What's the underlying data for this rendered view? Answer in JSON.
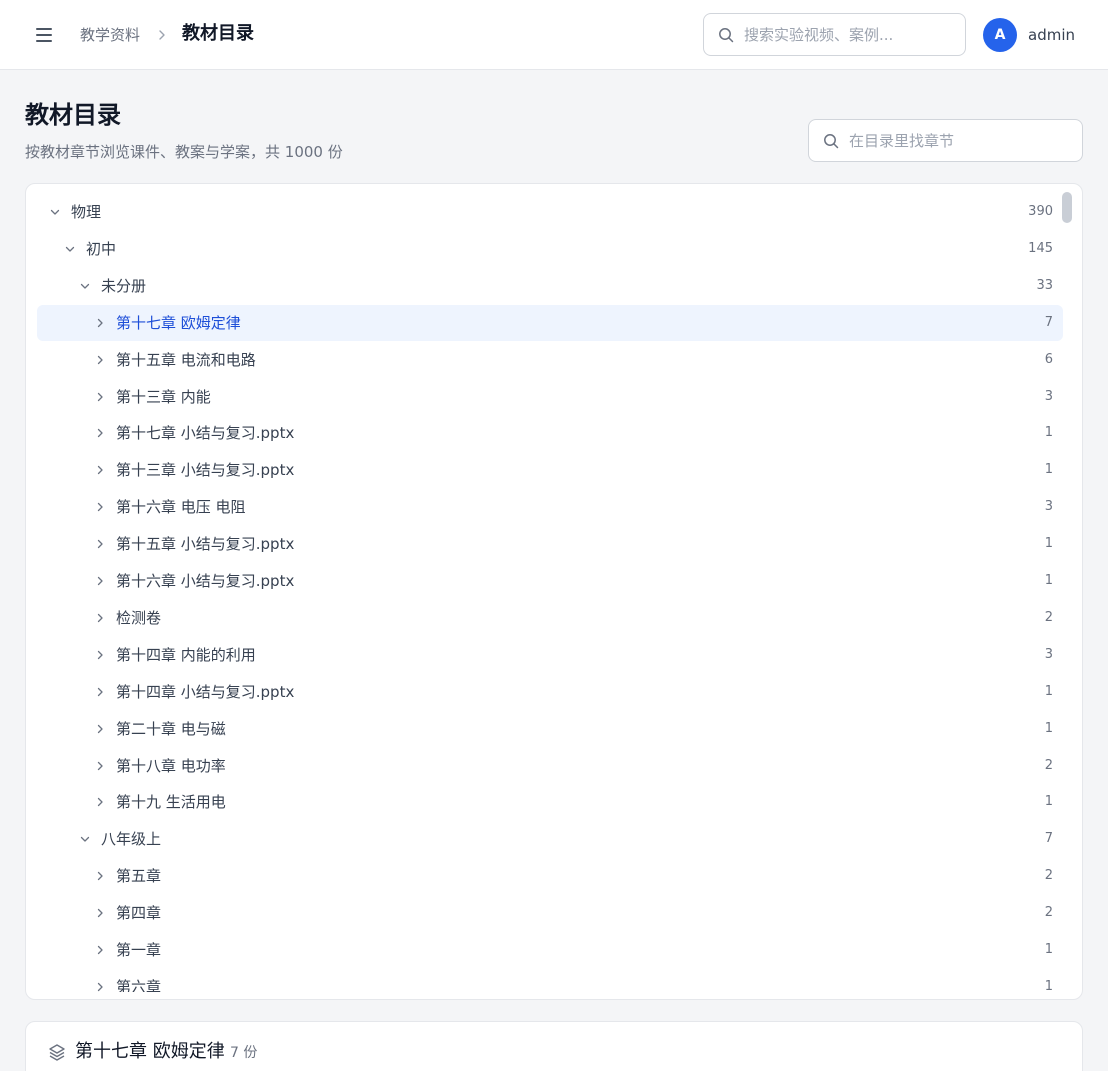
{
  "header": {
    "breadcrumb_parent": "教学资料",
    "breadcrumb_current": "教材目录",
    "search_placeholder": "搜索实验视频、案例...",
    "user": {
      "avatar_initial": "A",
      "name": "admin",
      "avatar_color": "#2563eb"
    }
  },
  "page": {
    "title": "教材目录",
    "subtitle": "按教材章节浏览课件、教案与学案，共 1000 份",
    "toc_search_placeholder": "在目录里找章节"
  },
  "tree": {
    "rows": [
      {
        "label": "物理",
        "count": "390",
        "level": 0,
        "expanded": true,
        "selected": false
      },
      {
        "label": "初中",
        "count": "145",
        "level": 1,
        "expanded": true,
        "selected": false
      },
      {
        "label": "未分册",
        "count": "33",
        "level": 2,
        "expanded": true,
        "selected": false
      },
      {
        "label": "第十七章 欧姆定律",
        "count": "7",
        "level": 3,
        "expanded": false,
        "selected": true
      },
      {
        "label": "第十五章 电流和电路",
        "count": "6",
        "level": 3,
        "expanded": false,
        "selected": false
      },
      {
        "label": "第十三章 内能",
        "count": "3",
        "level": 3,
        "expanded": false,
        "selected": false
      },
      {
        "label": "第十七章 小结与复习.pptx",
        "count": "1",
        "level": 3,
        "expanded": false,
        "selected": false
      },
      {
        "label": "第十三章 小结与复习.pptx",
        "count": "1",
        "level": 3,
        "expanded": false,
        "selected": false
      },
      {
        "label": "第十六章 电压 电阻",
        "count": "3",
        "level": 3,
        "expanded": false,
        "selected": false
      },
      {
        "label": "第十五章 小结与复习.pptx",
        "count": "1",
        "level": 3,
        "expanded": false,
        "selected": false
      },
      {
        "label": "第十六章 小结与复习.pptx",
        "count": "1",
        "level": 3,
        "expanded": false,
        "selected": false
      },
      {
        "label": "检测卷",
        "count": "2",
        "level": 3,
        "expanded": false,
        "selected": false
      },
      {
        "label": "第十四章 内能的利用",
        "count": "3",
        "level": 3,
        "expanded": false,
        "selected": false
      },
      {
        "label": "第十四章 小结与复习.pptx",
        "count": "1",
        "level": 3,
        "expanded": false,
        "selected": false
      },
      {
        "label": "第二十章 电与磁",
        "count": "1",
        "level": 3,
        "expanded": false,
        "selected": false
      },
      {
        "label": "第十八章 电功率",
        "count": "2",
        "level": 3,
        "expanded": false,
        "selected": false
      },
      {
        "label": "第十九 生活用电",
        "count": "1",
        "level": 3,
        "expanded": false,
        "selected": false
      },
      {
        "label": "八年级上",
        "count": "7",
        "level": 2,
        "expanded": true,
        "selected": false
      },
      {
        "label": "第五章",
        "count": "2",
        "level": 3,
        "expanded": false,
        "selected": false
      },
      {
        "label": "第四章",
        "count": "2",
        "level": 3,
        "expanded": false,
        "selected": false
      },
      {
        "label": "第一章",
        "count": "1",
        "level": 3,
        "expanded": false,
        "selected": false
      },
      {
        "label": "第六章",
        "count": "1",
        "level": 3,
        "expanded": false,
        "selected": false
      }
    ]
  },
  "detail": {
    "title": "第十七章 欧姆定律",
    "count_text": "7 份"
  },
  "colors": {
    "accent": "#2563eb",
    "selected_bg": "#eef4fe",
    "selected_text": "#1d4ed8",
    "page_bg": "#f4f5f7"
  },
  "icons": {
    "menu": "hamburger-icon",
    "breadcrumb_separator": "chevron-right-icon",
    "search": "search-icon",
    "tree_expanded": "chevron-down-icon",
    "tree_collapsed": "chevron-right-icon",
    "detail": "layers-icon"
  }
}
